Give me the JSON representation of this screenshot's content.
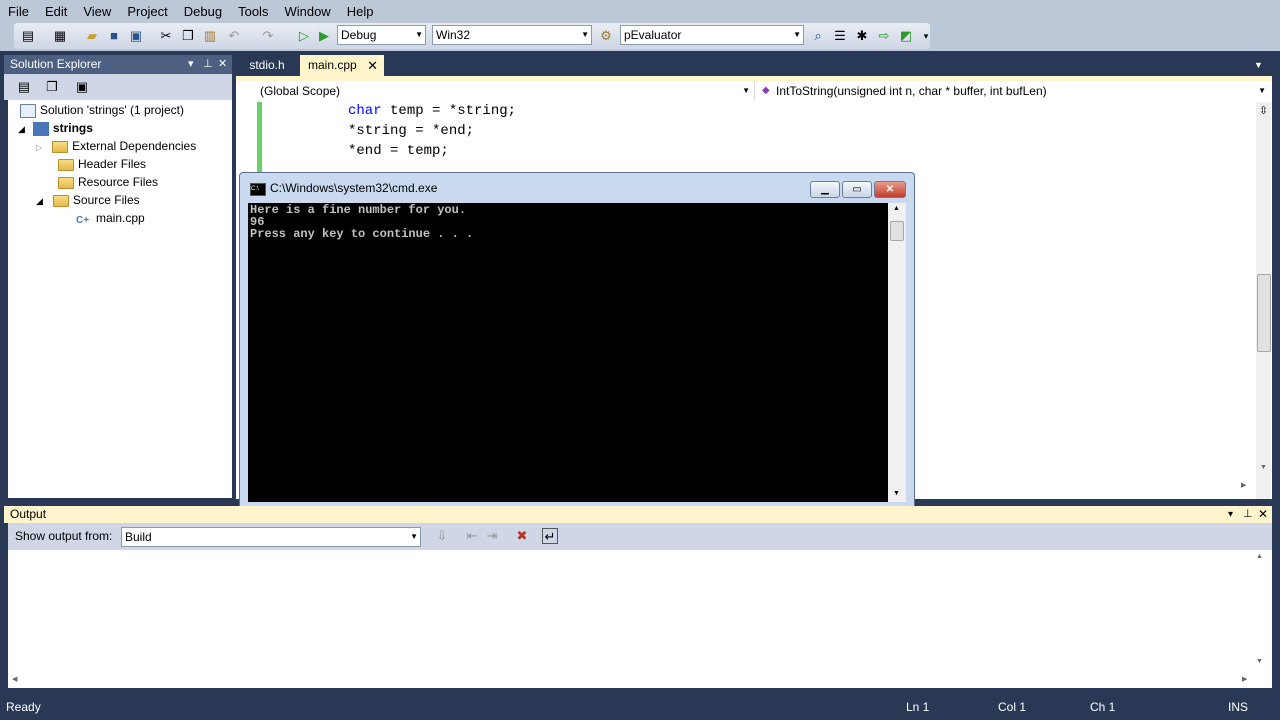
{
  "menu": [
    "File",
    "Edit",
    "View",
    "Project",
    "Debug",
    "Tools",
    "Window",
    "Help"
  ],
  "toolbar": {
    "config": "Debug",
    "platform": "Win32",
    "find": "pEvaluator"
  },
  "solution_explorer": {
    "title": "Solution Explorer",
    "solution": "Solution 'strings' (1 project)",
    "project": "strings",
    "items": [
      "External Dependencies",
      "Header Files",
      "Resource Files",
      "Source Files"
    ],
    "file": "main.cpp"
  },
  "tabs": [
    "stdio.h",
    "main.cpp"
  ],
  "scope": {
    "global": "(Global Scope)",
    "function": "IntToString(unsigned int n, char * buffer, int bufLen)"
  },
  "code": {
    "line1_kw": "char",
    "line1_rest": " temp = *string;",
    "line2": "*string = *end;",
    "line3": "*end = temp;"
  },
  "cmd": {
    "title": "C:\\Windows\\system32\\cmd.exe",
    "lines": [
      "Here is a fine number for you.",
      "96",
      "Press any key to continue . . ."
    ]
  },
  "output": {
    "title": "Output",
    "show_from_label": "Show output from:",
    "source": "Build"
  },
  "status": {
    "state": "Ready",
    "ln": "Ln 1",
    "col": "Col 1",
    "ch": "Ch 1",
    "mode": "INS"
  }
}
